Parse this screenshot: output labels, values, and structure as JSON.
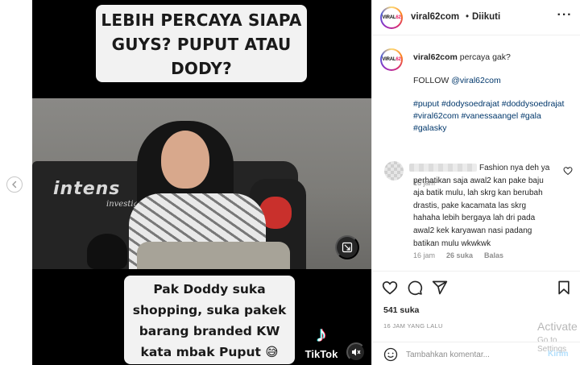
{
  "media": {
    "caption_top": [
      "LEBIH PERCAYA SIAPA",
      "GUYS? PUPUT ATAU",
      "DODY?"
    ],
    "caption_bottom": [
      "Pak Doddy suka",
      "shopping, suka pakek",
      "barang branded KW",
      "kata mbak Puput 😅"
    ],
    "video_logo": "intens",
    "video_logo_sub": "investigasi",
    "tiktok_label": "TikTok"
  },
  "header": {
    "avatar_text": "VIRAL",
    "avatar_accent": "62",
    "username": "viral62com",
    "separator": "•",
    "follow_state": "Diikuti",
    "more_label": "···"
  },
  "caption": {
    "username": "viral62com",
    "text": "percaya gak?",
    "follow_prefix": "FOLLOW",
    "mention": "@viral62com",
    "hashtags": [
      "#puput",
      "#dodysoedrajat",
      "#doddysoedrajat",
      "#viral62com",
      "#vanessaangel",
      "#gala",
      "#galasky"
    ],
    "time": "16 jam"
  },
  "comment": {
    "lines": [
      "Fashion nya deh ya",
      "perhatikan saja awal2 kan pake baju",
      "aja batik mulu, lah skrg kan berubah",
      "drastis, pake kacamata las skrg",
      "hahaha lebih bergaya lah dri pada",
      "awal2 kek karyawan nasi padang",
      "batikan mulu wkwkwk"
    ],
    "time": "16 jam",
    "likes": "26 suka",
    "reply": "Balas"
  },
  "actions": {
    "likes": "541 suka",
    "time_ago": "16 JAM YANG LALU"
  },
  "comment_box": {
    "placeholder": "Tambahkan komentar...",
    "post_label": "Kirim"
  },
  "overlay": {
    "activate": "Activate",
    "go_to_settings": "Go to Settings"
  },
  "colors": {
    "link": "#00376b",
    "muted": "#8e8e8e",
    "post_disabled": "#b2dffc"
  }
}
